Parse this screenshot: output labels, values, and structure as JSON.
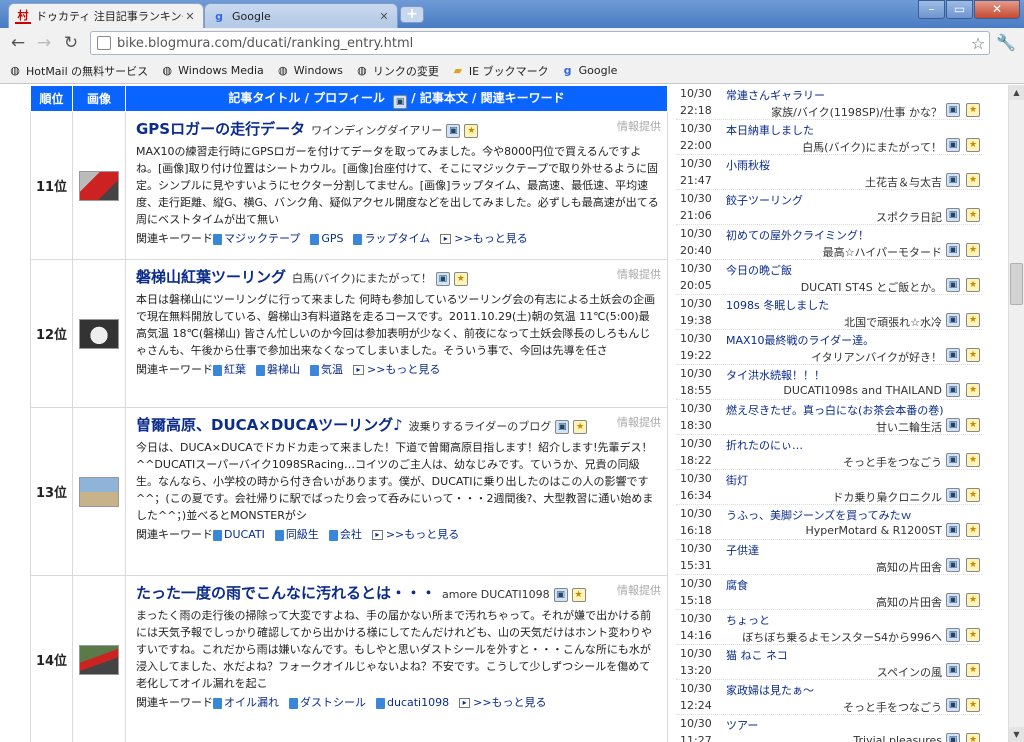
{
  "browser": {
    "tabs": [
      {
        "title": "ドゥカティ 注目記事ランキング・"
      },
      {
        "title": "Google"
      }
    ],
    "url_host": "bike.blogmura.com",
    "url_path": "/ducati/ranking_entry.html",
    "url": "bike.blogmura.com/ducati/ranking_entry.html",
    "bookmarks": [
      "HotMail の無料サービス",
      "Windows Media",
      "Windows",
      "リンクの変更",
      "IE ブックマーク",
      "Google"
    ]
  },
  "ranking": {
    "headers": {
      "rank": "順位",
      "image": "画像",
      "main": "記事タイトル / プロフィール",
      "main_tail": " / 記事本文 / 関連キーワード"
    },
    "info_label": "情報提供",
    "kw_label": "関連キーワード",
    "more_label": ">>もっと見る",
    "entries": [
      {
        "rank": "11位",
        "title": "GPSロガーの走行データ",
        "blog": "ワインディングダイアリー",
        "body": "MAX10の練習走行時にGPSロガーを付けてデータを取ってみました。今や8000円位で買えるんですよね。[画像]取り付け位置はシートカウル。[画像]台座付けて、そこにマジックテープで取り外せるように固定。シンプルに見やすいようにセクター分割してません。[画像]ラップタイム、最高速、最低速、平均速度、走行距離、縦G、横G、バンク角、疑似アクセル開度などを出してみました。必ずしも最高速が出てる周にベストタイムが出て無い",
        "keywords": [
          "マジックテープ",
          "GPS",
          "ラップタイム"
        ]
      },
      {
        "rank": "12位",
        "title": "磐梯山紅葉ツーリング",
        "blog": "白馬(バイク)にまたがって！",
        "body": "本日は磐梯山にツーリングに行って来ました 何時も参加しているツーリング会の有志による土妖会の企画で現在無料開放している、磐梯山3有料道路を走るコースです。2011.10.29(土)朝の気温 11℃(5:00)最高気温 18℃(磐梯山) 皆さん忙しいのか今回は参加表明が少なく、前夜になって土妖会隊長のしろもんじゃさんも、午後から仕事で参加出来なくなってしまいました。そういう事で、今回は先導を任さ",
        "keywords": [
          "紅葉",
          "磐梯山",
          "気温"
        ]
      },
      {
        "rank": "13位",
        "title": "曽爾高原、DUCA×DUCAツーリング♪",
        "blog": "波乗りするライダーのブログ",
        "body": "今日は、DUCA×DUCAでドカドカ走って来ました！下道で曽爾高原目指します！紹介します!先輩デス！^^DUCATIスーパーバイク1098SRacing…コイツのご主人は、幼なじみです。ていうか、兄貴の同級生。なんなら、小学校の時から付き合いがあります。僕が、DUCATIに乗り出したのはこの人の影響です^^；(この夏です。会社帰りに駅でばったり会って呑みにいって・・・2週間後?、大型教習に通い始めました^^；)並べるとMONSTERがシ",
        "keywords": [
          "DUCATI",
          "同級生",
          "会社"
        ]
      },
      {
        "rank": "14位",
        "title": "たった一度の雨でこんなに汚れるとは・・・",
        "blog": "amore DUCATI1098",
        "body": "まったく雨の走行後の掃除って大変ですよね、手の届かない所まで汚れちゃって。それが嫌で出かける前には天気予報でしっかり確認してから出かける様にしてたんだけれども、山の天気だけはホント変わりやすいですね。これだから雨は嫌いなんです。もしやと思いダストシールを外すと・・・こんな所にも水が浸入してました、水だよね？フォークオイルじゃないよね？不安です。こうして少しずつシールを傷めて老化してオイル漏れを起こ",
        "keywords": [
          "オイル漏れ",
          "ダストシール",
          "ducati1098"
        ]
      }
    ]
  },
  "side_list": [
    {
      "date": "10/30",
      "title": "常連さんギャラリー",
      "time": "22:18",
      "blog": "家族/バイク(1198SP)/仕事 かな？"
    },
    {
      "date": "10/30",
      "title": "本日納車しました",
      "time": "22:00",
      "blog": "白馬(バイク)にまたがって！"
    },
    {
      "date": "10/30",
      "title": "小雨秋桜",
      "time": "21:47",
      "blog": "土花吉＆与太吉"
    },
    {
      "date": "10/30",
      "title": "餃子ツーリング",
      "time": "21:06",
      "blog": "スポクラ日記"
    },
    {
      "date": "10/30",
      "title": "初めての屋外クライミング！",
      "time": "20:40",
      "blog": "最高☆ハイパーモタード"
    },
    {
      "date": "10/30",
      "title": "今日の晩ご飯",
      "time": "20:05",
      "blog": "DUCATI ST4S とご飯とか。"
    },
    {
      "date": "10/30",
      "title": "1098s 冬眠しました",
      "time": "19:38",
      "blog": "北国で頑張れ☆水冷"
    },
    {
      "date": "10/30",
      "title": "MAX10最終戦のライダー達。",
      "time": "19:22",
      "blog": "イタリアンバイクが好き！"
    },
    {
      "date": "10/30",
      "title": "タイ洪水続報！！！",
      "time": "18:55",
      "blog": "DUCATI1098s and THAILAND"
    },
    {
      "date": "10/30",
      "title": "燃え尽きたぜ。真っ白にな(お茶会本番の巻)",
      "time": "18:30",
      "blog": "甘い二輪生活"
    },
    {
      "date": "10/30",
      "title": "折れたのにぃ…",
      "time": "18:22",
      "blog": "そっと手をつなごう"
    },
    {
      "date": "10/30",
      "title": "街灯",
      "time": "16:34",
      "blog": "ドカ乗り梟クロニクル"
    },
    {
      "date": "10/30",
      "title": "うふっ、美脚ジーンズを買ってみたｗ",
      "time": "16:18",
      "blog": "HyperMotard & R1200ST"
    },
    {
      "date": "10/30",
      "title": "子供達",
      "time": "15:31",
      "blog": "高知の片田舎"
    },
    {
      "date": "10/30",
      "title": "腐食",
      "time": "15:18",
      "blog": "高知の片田舎"
    },
    {
      "date": "10/30",
      "title": "ちょっと",
      "time": "14:16",
      "blog": "ぼちぼち乗るよモンスターS4から996へ"
    },
    {
      "date": "10/30",
      "title": "猫 ねこ ネコ",
      "time": "13:20",
      "blog": "スペインの風"
    },
    {
      "date": "10/30",
      "title": "家政婦は見たぁ〜",
      "time": "12:24",
      "blog": "そっと手をつなごう"
    },
    {
      "date": "10/30",
      "title": "ツアー",
      "time": "11:27",
      "blog": "Trivial pleasures"
    }
  ],
  "colors": {
    "header_blue": "#0a64ff",
    "link": "#0b2c8a",
    "chrome_blue": "#4a7cc3"
  }
}
